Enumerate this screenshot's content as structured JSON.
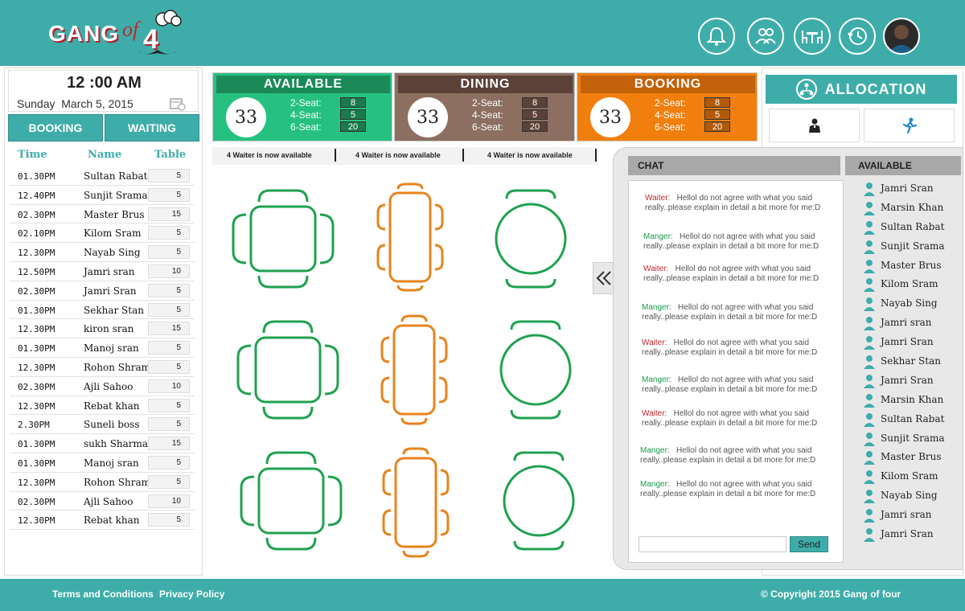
{
  "brand": {
    "logo_main": "GANG",
    "logo_of": "of",
    "logo_num": "4"
  },
  "header_icons": [
    "bell-icon",
    "users-icon",
    "table-icon",
    "history-icon"
  ],
  "clock": {
    "time": "12 :00 AM",
    "day": "Sunday",
    "date": "March 5, 2015"
  },
  "left_tabs": {
    "booking": "BOOKING",
    "waiting": "WAITING"
  },
  "reservations": {
    "headers": {
      "time": "Time",
      "name": "Name",
      "table": "Table"
    },
    "rows": [
      {
        "time": "01.30PM",
        "name": "Sultan Rabat",
        "table": "5"
      },
      {
        "time": "12.40PM",
        "name": "Sunjit Srama",
        "table": "5"
      },
      {
        "time": "02.30PM",
        "name": "Master Brus",
        "table": "15"
      },
      {
        "time": "02.10PM",
        "name": "Kilom Sram",
        "table": "5"
      },
      {
        "time": "12.30PM",
        "name": "Nayab Sing",
        "table": "5"
      },
      {
        "time": "12.50PM",
        "name": "Jamri sran",
        "table": "10"
      },
      {
        "time": "02.30PM",
        "name": "Jamri Sran",
        "table": "5"
      },
      {
        "time": "01.30PM",
        "name": "Sekhar Stan",
        "table": "5"
      },
      {
        "time": "12.30PM",
        "name": "kiron sran",
        "table": "15"
      },
      {
        "time": "01.30PM",
        "name": "Manoj sran",
        "table": "5"
      },
      {
        "time": "12.30PM",
        "name": "Rohon Shrama",
        "table": "5"
      },
      {
        "time": "02.30PM",
        "name": "Ajli Sahoo",
        "table": "10"
      },
      {
        "time": "12.30PM",
        "name": "Rebat khan",
        "table": "5"
      },
      {
        "time": "2.30PM",
        "name": "Suneli boss",
        "table": "5"
      },
      {
        "time": "01.30PM",
        "name": "sukh Sharma",
        "table": "15"
      },
      {
        "time": "01.30PM",
        "name": "Manoj sran",
        "table": "5"
      },
      {
        "time": "12.30PM",
        "name": "Rohon Shrama",
        "table": "5"
      },
      {
        "time": "02.30PM",
        "name": "Ajli Sahoo",
        "table": "10"
      },
      {
        "time": "12.30PM",
        "name": "Rebat khan",
        "table": "5"
      }
    ]
  },
  "status": {
    "available": {
      "title": "AVAILABLE",
      "count": "33",
      "two_label": "2-Seat:",
      "four_label": "4-Seat:",
      "six_label": "6-Seat:",
      "two": "8",
      "four": "5",
      "six": "20",
      "color": "#26c181"
    },
    "dining": {
      "title": "DINING",
      "count": "33",
      "two_label": "2-Seat:",
      "four_label": "4-Seat:",
      "six_label": "6-Seat:",
      "two": "8",
      "four": "5",
      "six": "20",
      "color": "#8c6f61"
    },
    "booking": {
      "title": "BOOKING",
      "count": "33",
      "two_label": "2-Seat:",
      "four_label": "4-Seat:",
      "six_label": "6-Seat:",
      "two": "8",
      "four": "5",
      "six": "20",
      "color": "#f07f0e"
    }
  },
  "ticker": [
    "4 Waiter is now available",
    "4 Waiter is now available",
    "4 Waiter is now available"
  ],
  "allocation": {
    "title": "ALLOCATION"
  },
  "chat": {
    "title": "CHAT",
    "messages": [
      {
        "role": "Waiter",
        "text": "Hellol do not agree with what you said really..please explain in detail a bit more for me:D"
      },
      {
        "role": "Manger",
        "text": "Hellol do not agree with what you said really..please explain in detail a bit more for me:D"
      },
      {
        "role": "Waiter",
        "text": "Hellol do not agree with what you said really..please explain in detail a bit more for me:D"
      },
      {
        "role": "Manger",
        "text": "Hellol do not agree with what you said really..please explain in detail a bit more for me:D"
      },
      {
        "role": "Waiter",
        "text": "Hellol do not agree with what you said really..please explain in detail a bit more for me:D"
      },
      {
        "role": "Manger",
        "text": "Hellol do not agree with what you said really..please explain in detail a bit more for me:D"
      },
      {
        "role": "Waiter",
        "text": "Hellol do not agree with what you said really..please explain in detail a bit more for me:D"
      },
      {
        "role": "Manger",
        "text": "Hellol do not agree with what you said really..please explain in detail a bit more for me:D"
      },
      {
        "role": "Manger",
        "text": "Hellol do not agree with what you said really..please explain in detail a bit more for me:D"
      }
    ],
    "input_value": "",
    "send_label": "Send"
  },
  "available_staff": {
    "title": "AVAILABLE",
    "names": [
      "Jamri Sran",
      "Marsin Khan",
      "Sultan Rabat",
      "Sunjit Srama",
      "Master Brus",
      "Kilom Sram",
      "Nayab Sing",
      "Jamri sran",
      "Jamri Sran",
      "Sekhar Stan",
      "Jamri Sran",
      "Marsin Khan",
      "Sultan Rabat",
      "Sunjit Srama",
      "Master Brus",
      "Kilom Sram",
      "Nayab Sing",
      "Jamri sran",
      "Jamri Sran"
    ]
  },
  "footer": {
    "terms": "Terms and Conditions",
    "privacy": "Privacy Policy",
    "copyright": "© Copyright 2015 Gang of four"
  },
  "colors": {
    "teal": "#3eada9",
    "green": "#1fa24f",
    "orange": "#e9831c",
    "waiter_red": "#c0272d",
    "manager_green": "#1a9a4d"
  }
}
